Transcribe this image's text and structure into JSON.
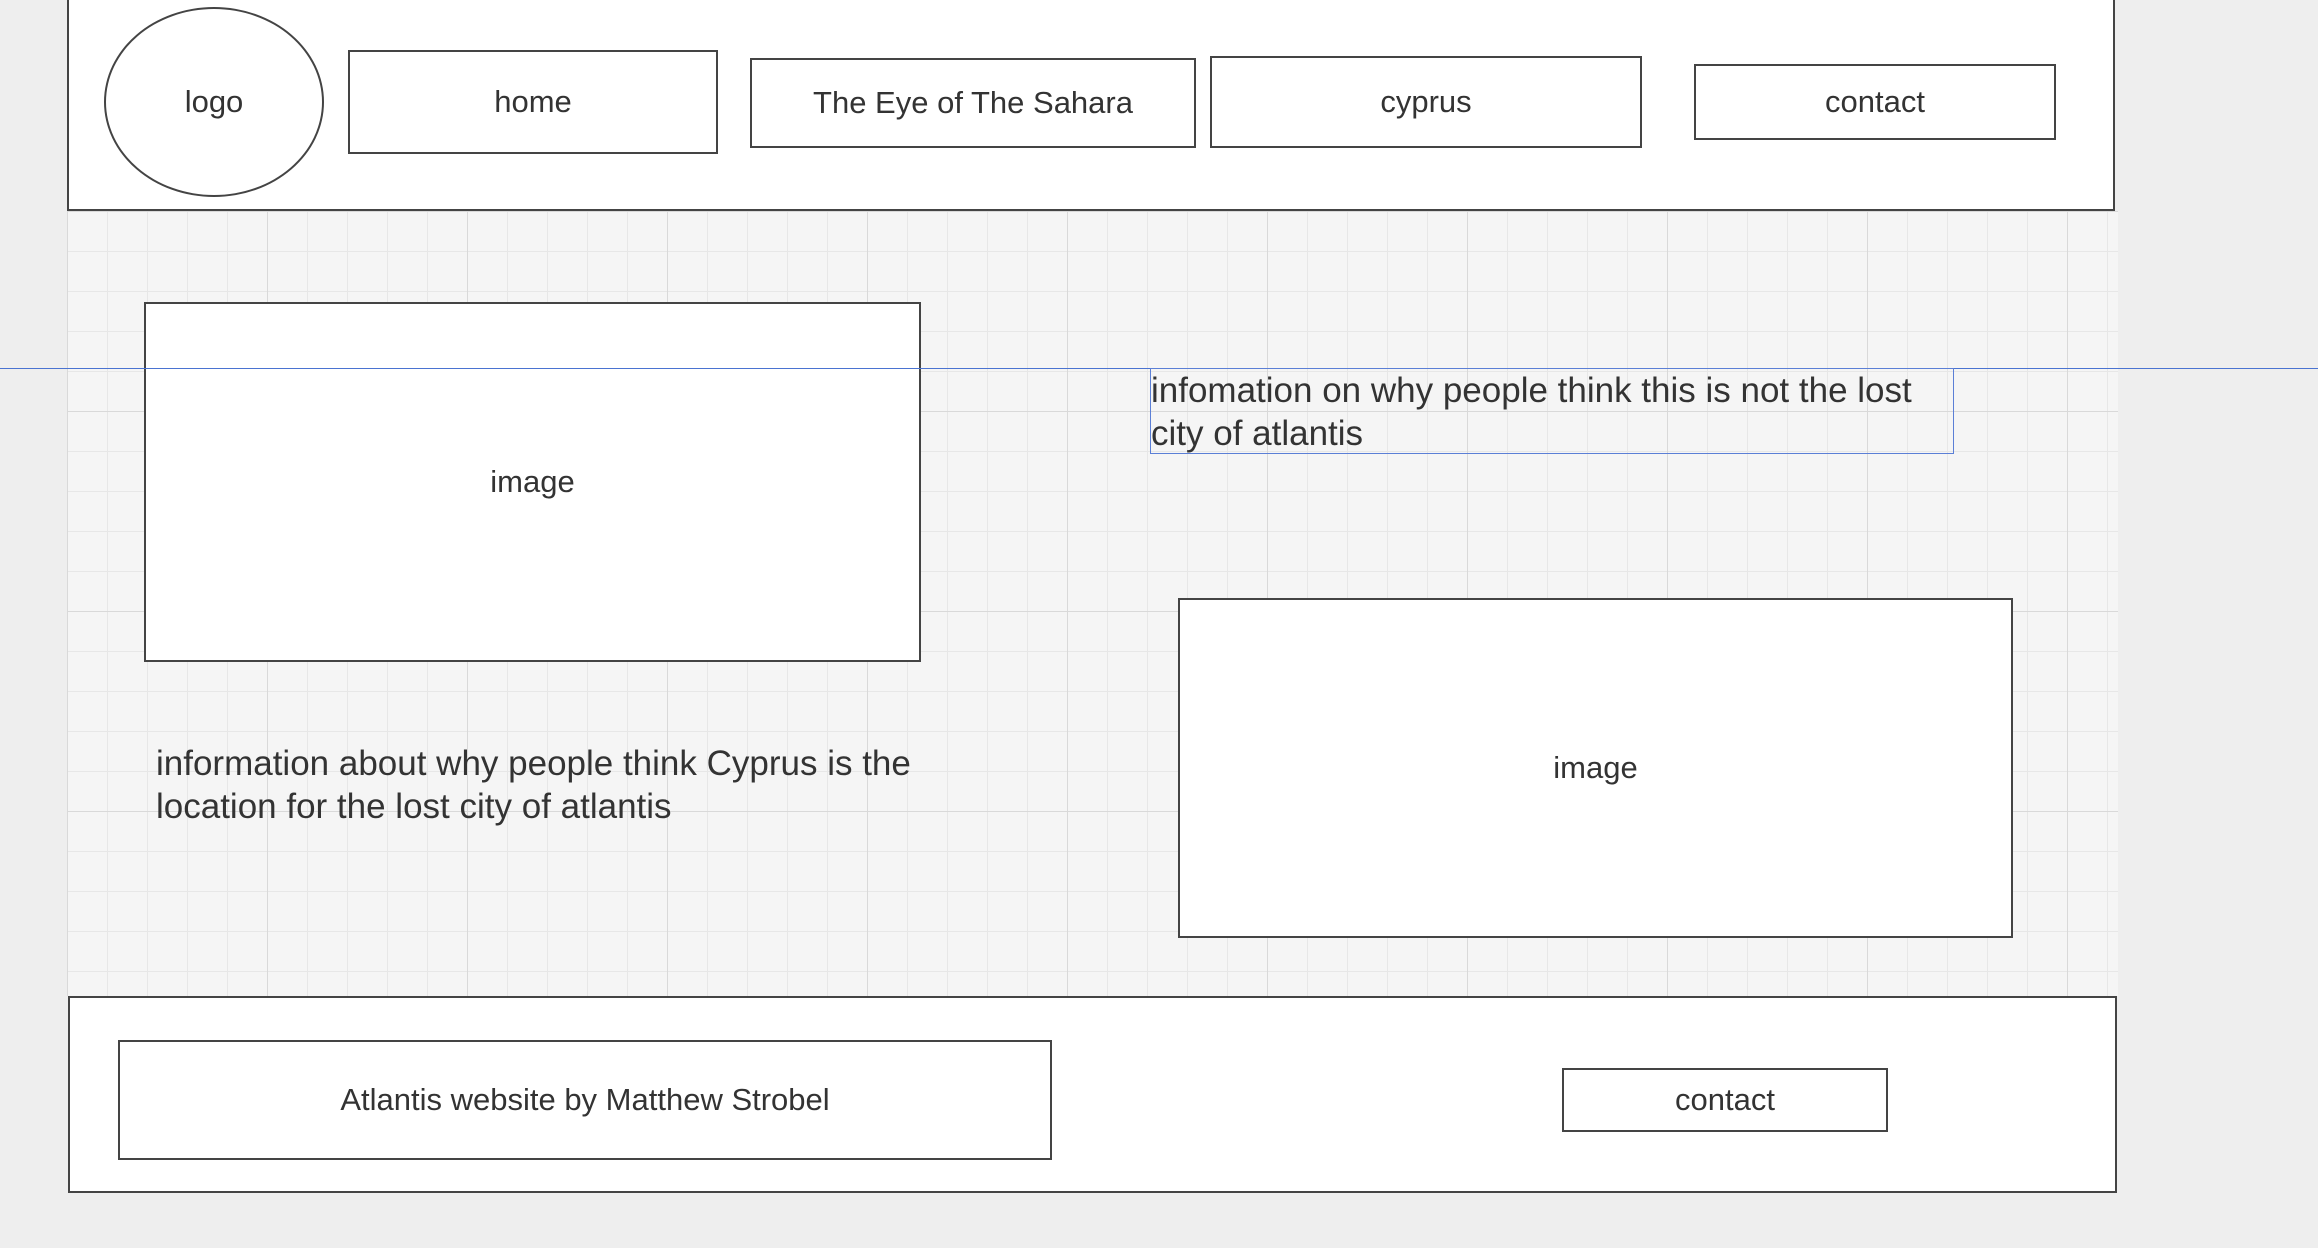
{
  "header": {
    "logo_label": "logo",
    "nav": {
      "home": "home",
      "sahara": "The Eye of The Sahara",
      "cyprus": "cyprus",
      "contact": "contact"
    }
  },
  "main": {
    "left_image_label": "image",
    "left_text": "information about why people think Cyprus is the location for the lost city of atlantis",
    "right_text": "infomation on why people think this is not the lost city of atlantis",
    "right_image_label": "image"
  },
  "footer": {
    "credit": "Atlantis website by Matthew Strobel",
    "contact": "contact"
  },
  "colors": {
    "background": "#eeeeee",
    "grid_background": "#f5f5f5",
    "border": "#444444",
    "text": "#333333",
    "selection": "#4a73d1"
  }
}
